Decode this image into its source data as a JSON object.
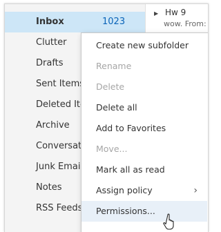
{
  "folders": [
    {
      "label": "Inbox",
      "count": "1023"
    },
    {
      "label": "Clutter"
    },
    {
      "label": "Drafts"
    },
    {
      "label": "Sent Items"
    },
    {
      "label": "Deleted Items"
    },
    {
      "label": "Archive"
    },
    {
      "label": "Conversation History"
    },
    {
      "label": "Junk Email"
    },
    {
      "label": "Notes"
    },
    {
      "label": "RSS Feeds"
    }
  ],
  "message_pane": {
    "sender": "Hw 9",
    "preview": "wow. From:"
  },
  "context_menu": {
    "items": [
      {
        "label": "Create new subfolder",
        "disabled": false
      },
      {
        "label": "Rename",
        "disabled": true
      },
      {
        "label": "Delete",
        "disabled": true
      },
      {
        "label": "Delete all",
        "disabled": false
      },
      {
        "label": "Add to Favorites",
        "disabled": false
      },
      {
        "label": "Move...",
        "disabled": true
      },
      {
        "label": "Mark all as read",
        "disabled": false
      },
      {
        "label": "Assign policy",
        "disabled": false,
        "submenu": true
      },
      {
        "label": "Permissions...",
        "disabled": false
      }
    ],
    "hovered_item": "Permissions...",
    "submenu_icon": "chevron-right-icon"
  },
  "colors": {
    "selected_folder_bg": "#cde6f7",
    "count_color": "#0a64b8",
    "disabled_text": "#a6a6a6"
  }
}
